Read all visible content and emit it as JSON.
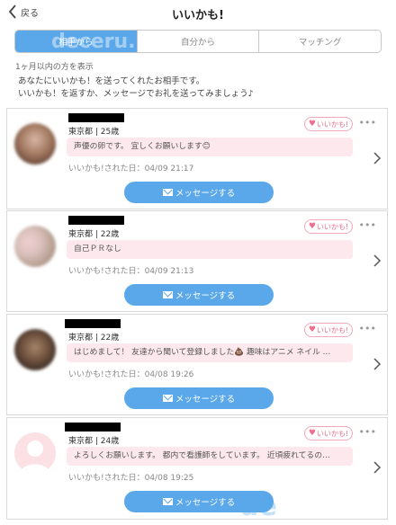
{
  "header": {
    "back_label": "戻る",
    "title": "いいかも!"
  },
  "tabs": [
    {
      "label": "相手から",
      "active": true
    },
    {
      "label": "自分から",
      "active": false
    },
    {
      "label": "マッチング",
      "active": false
    }
  ],
  "watermark": "de",
  "tab_watermark": "deceru.",
  "subtitle": "1ヶ月以内の方を表示",
  "intro": {
    "line1": "あなたにいいかも！を送ってくれたお相手です。",
    "line2": "いいかも！を返すか、メッセージでお礼を送ってみましょう♪"
  },
  "cards": [
    {
      "meta": "東京都 | 25歳",
      "like_label": "いいかも!",
      "message": "声優の卵です。 宜しくお願いします😊",
      "date_label": "いいかも!された日：",
      "date": "04/09 21:17",
      "button_label": "メッセージする"
    },
    {
      "meta": "東京都 | 22歳",
      "like_label": "いいかも!",
      "message": "自己ＰＲなし",
      "date_label": "いいかも!された日：",
      "date": "04/09 21:13",
      "button_label": "メッセージする"
    },
    {
      "meta": "東京都 | 22歳",
      "like_label": "いいかも!",
      "message": "はじめまして！ 友達から聞いて登録しました💩 趣味はアニメ ネイル …",
      "date_label": "いいかも!された日：",
      "date": "04/08 19:26",
      "button_label": "メッセージする"
    },
    {
      "meta": "東京都 | 24歳",
      "like_label": "いいかも!",
      "message": "よろしくお願いします。 都内で看護師をしています。 近頃疲れてるの…",
      "date_label": "いいかも!された日：",
      "date": "04/08 19:25",
      "button_label": "メッセージする"
    }
  ],
  "colors": {
    "accent": "#5aa8ea",
    "like_pink": "#ef6f8e",
    "message_bg": "#fde8ee"
  }
}
